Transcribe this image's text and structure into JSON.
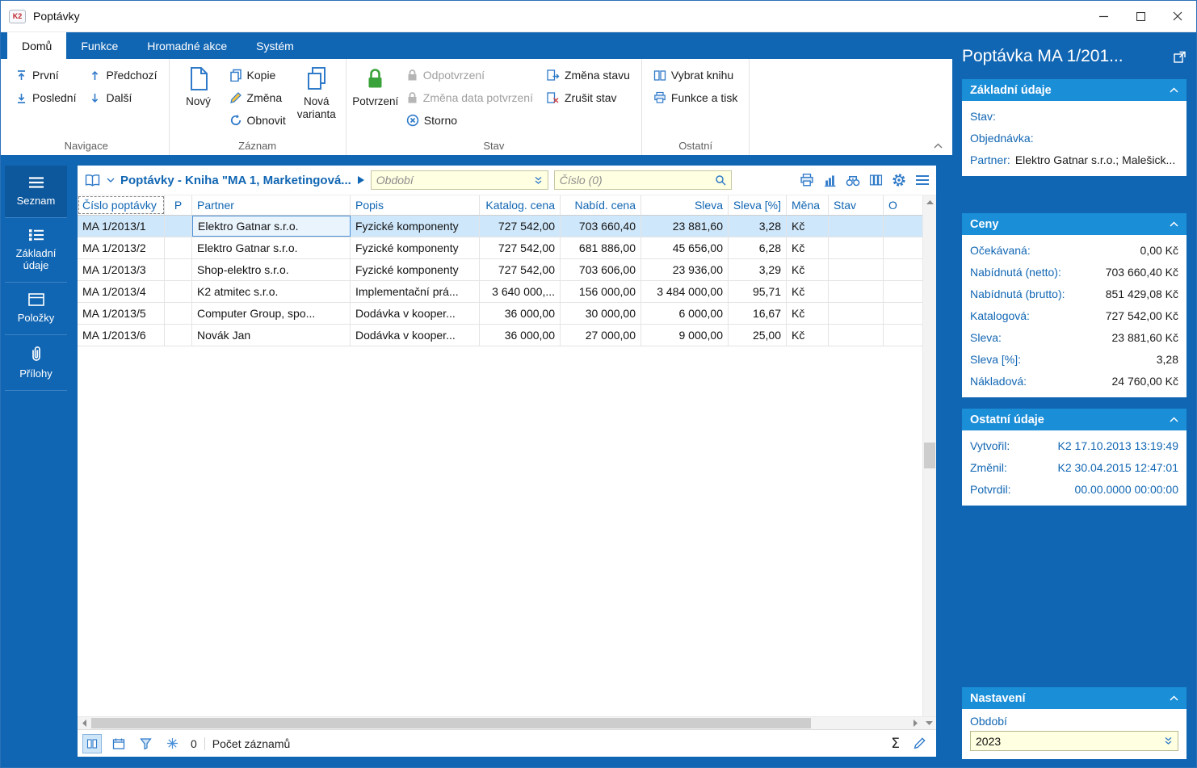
{
  "window": {
    "title": "Poptávky",
    "app_icon_text": "K2"
  },
  "colors": {
    "accent_blue": "#1166b3",
    "section_header_blue": "#1b8ed8",
    "selected_row_blue": "#cfe7fa",
    "filter_yellow": "#ffffe1",
    "confirm_green": "#3aa23a"
  },
  "ribbon": {
    "tabs": [
      "Domů",
      "Funkce",
      "Hromadné akce",
      "Systém"
    ],
    "navigace": {
      "label": "Navigace",
      "first": "První",
      "last": "Poslední",
      "prev": "Předchozí",
      "next": "Další"
    },
    "zaznam": {
      "label": "Záznam",
      "novy": "Nový",
      "kopie": "Kopie",
      "zmena": "Změna",
      "obnovit": "Obnovit",
      "nova_varianta": "Nová varianta"
    },
    "stav": {
      "label": "Stav",
      "potvrzeni": "Potvrzení",
      "odpotvrzeni": "Odpotvrzení",
      "zmena_data": "Změna data potvrzení",
      "storno": "Storno",
      "zmena_stavu": "Změna stavu",
      "zrusit_stav": "Zrušit stav"
    },
    "ostatni": {
      "label": "Ostatní",
      "vybrat_knihu": "Vybrat knihu",
      "funkce_a_tisk": "Funkce a tisk"
    }
  },
  "sidebar": {
    "items": [
      {
        "label": "Seznam"
      },
      {
        "label": "Základní údaje"
      },
      {
        "label": "Položky"
      },
      {
        "label": "Přílohy"
      }
    ]
  },
  "toolbar": {
    "title": "Poptávky - Kniha \"MA 1, Marketingová...",
    "period_placeholder": "Období",
    "number_placeholder": "Číslo (0)"
  },
  "table": {
    "columns": [
      "Číslo poptávky",
      "P",
      "Partner",
      "Popis",
      "Katalog. cena",
      "Nabíd. cena",
      "Sleva",
      "Sleva [%]",
      "Měna",
      "Stav",
      "O"
    ],
    "rows": [
      {
        "cells": [
          "MA 1/2013/1",
          "",
          "Elektro Gatnar s.r.o.",
          "Fyzické komponenty",
          "727 542,00",
          "703 660,40",
          "23 881,60",
          "3,28",
          "Kč",
          "",
          ""
        ]
      },
      {
        "cells": [
          "MA 1/2013/2",
          "",
          "Elektro Gatnar s.r.o.",
          "Fyzické komponenty",
          "727 542,00",
          "681 886,00",
          "45 656,00",
          "6,28",
          "Kč",
          "",
          ""
        ]
      },
      {
        "cells": [
          "MA 1/2013/3",
          "",
          "Shop-elektro s.r.o.",
          "Fyzické komponenty",
          "727 542,00",
          "703 606,00",
          "23 936,00",
          "3,29",
          "Kč",
          "",
          ""
        ]
      },
      {
        "cells": [
          "MA 1/2013/4",
          "",
          "K2 atmitec s.r.o.",
          "Implementační prá...",
          "3 640 000,...",
          "156 000,00",
          "3 484 000,00",
          "95,71",
          "Kč",
          "",
          ""
        ]
      },
      {
        "cells": [
          "MA 1/2013/5",
          "",
          "Computer Group, spo...",
          "Dodávka v kooper...",
          "36 000,00",
          "30 000,00",
          "6 000,00",
          "16,67",
          "Kč",
          "",
          ""
        ]
      },
      {
        "cells": [
          "MA 1/2013/6",
          "",
          "Novák Jan",
          "Dodávka v kooper...",
          "36 000,00",
          "27 000,00",
          "9 000,00",
          "25,00",
          "Kč",
          "",
          ""
        ]
      }
    ]
  },
  "statusbar": {
    "count": "0",
    "records_label": "Počet záznamů",
    "sigma": "Σ"
  },
  "detail": {
    "title": "Poptávka MA 1/201...",
    "zakladni": {
      "header": "Základní údaje",
      "stav_label": "Stav:",
      "objednavka_label": "Objednávka:",
      "partner_label": "Partner:",
      "partner_value": "Elektro Gatnar s.r.o.; Malešick..."
    },
    "ceny": {
      "header": "Ceny",
      "rows": [
        {
          "label": "Očekávaná:",
          "value": "0,00 Kč"
        },
        {
          "label": "Nabídnutá (netto):",
          "value": "703 660,40 Kč"
        },
        {
          "label": "Nabídnutá (brutto):",
          "value": "851 429,08 Kč"
        },
        {
          "label": "Katalogová:",
          "value": "727 542,00 Kč"
        },
        {
          "label": "Sleva:",
          "value": "23 881,60 Kč"
        },
        {
          "label": "Sleva [%]:",
          "value": "3,28"
        },
        {
          "label": "Nákladová:",
          "value": "24 760,00 Kč"
        }
      ]
    },
    "ostatni": {
      "header": "Ostatní údaje",
      "rows": [
        {
          "label": "Vytvořil:",
          "value": "K2 17.10.2013 13:19:49"
        },
        {
          "label": "Změnil:",
          "value": "K2 30.04.2015 12:47:01"
        },
        {
          "label": "Potvrdil:",
          "value": "00.00.0000 00:00:00"
        }
      ]
    },
    "nastaveni": {
      "header": "Nastavení",
      "obdobi_label": "Období",
      "obdobi_value": "2023"
    }
  }
}
